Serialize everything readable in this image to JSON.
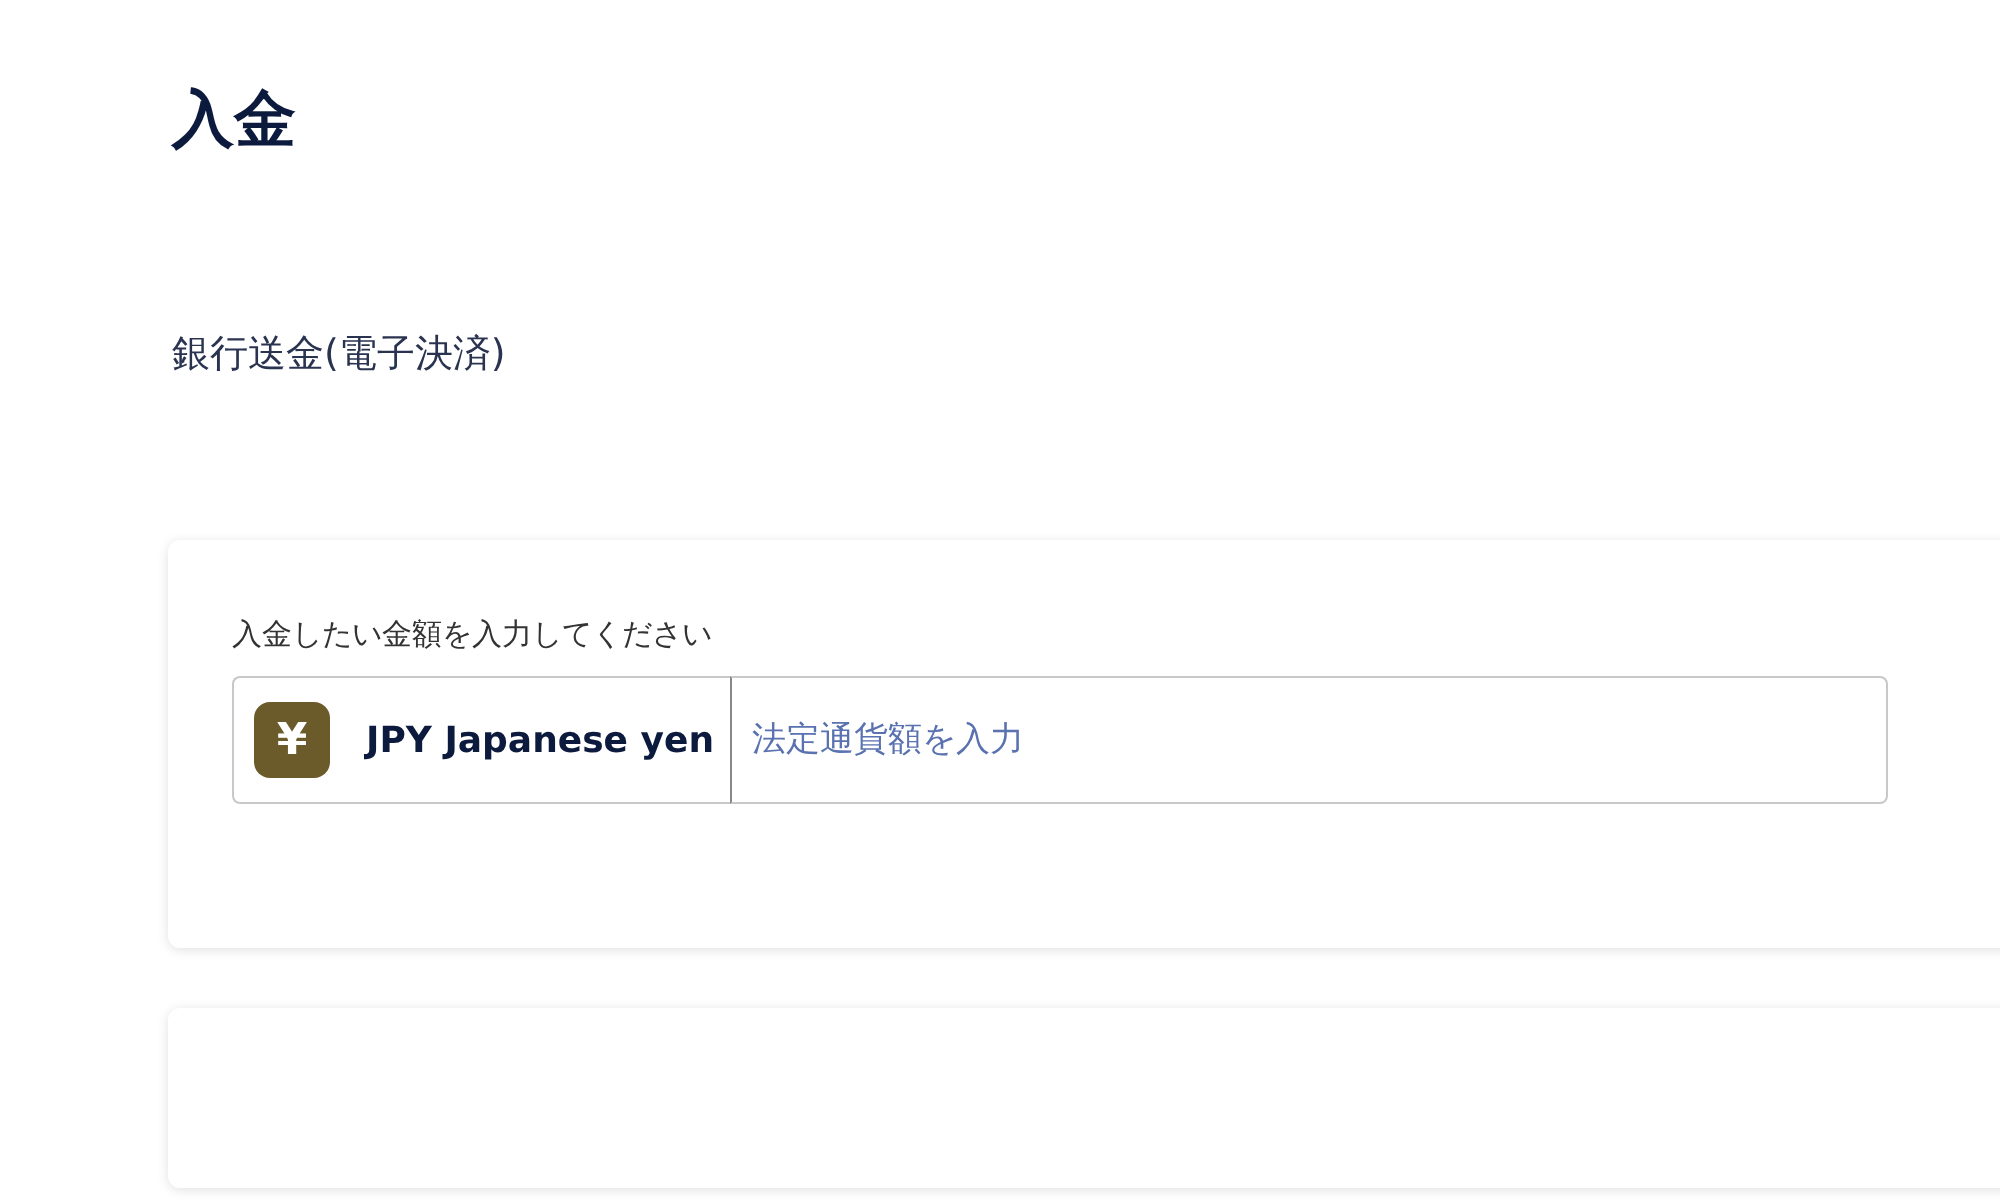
{
  "page": {
    "title": "入金",
    "method": "銀行送金(電子決済)"
  },
  "amount_card": {
    "label": "入金したい金額を入力してください",
    "currency": {
      "symbol": "¥",
      "name": "JPY Japanese yen"
    },
    "amount_field": {
      "placeholder": "法定通貨額を入力"
    }
  }
}
